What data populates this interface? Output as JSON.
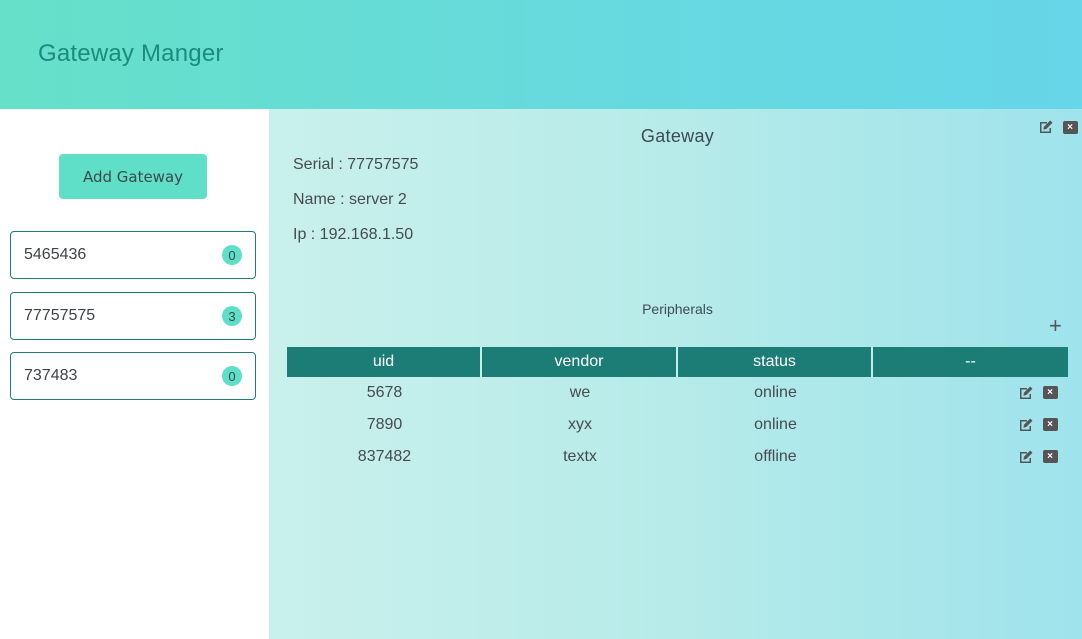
{
  "header": {
    "title": "Gateway Manger"
  },
  "sidebar": {
    "add_button_label": "Add Gateway",
    "gateways": [
      {
        "serial": "5465436",
        "count": "0"
      },
      {
        "serial": "77757575",
        "count": "3"
      },
      {
        "serial": "737483",
        "count": "0"
      }
    ]
  },
  "detail": {
    "title": "Gateway",
    "serial_line": "Serial : 77757575",
    "name_line": "Name : server 2",
    "ip_line": "Ip : 192.168.1.50",
    "icons": [
      "edit-icon",
      "close-icon"
    ]
  },
  "peripherals": {
    "title": "Peripherals",
    "add_symbol": "+",
    "columns": [
      "uid",
      "vendor",
      "status",
      "--"
    ],
    "rows": [
      {
        "uid": "5678",
        "vendor": "we",
        "status": "online"
      },
      {
        "uid": "7890",
        "vendor": "xyx",
        "status": "online"
      },
      {
        "uid": "837482",
        "vendor": "textx",
        "status": "offline"
      }
    ]
  },
  "colors": {
    "header_gradient_start": "#66e0c8",
    "header_gradient_end": "#66d6e8",
    "accent": "#5fdfc8",
    "table_header": "#1c7d76",
    "title_text": "#1c8a7f"
  }
}
